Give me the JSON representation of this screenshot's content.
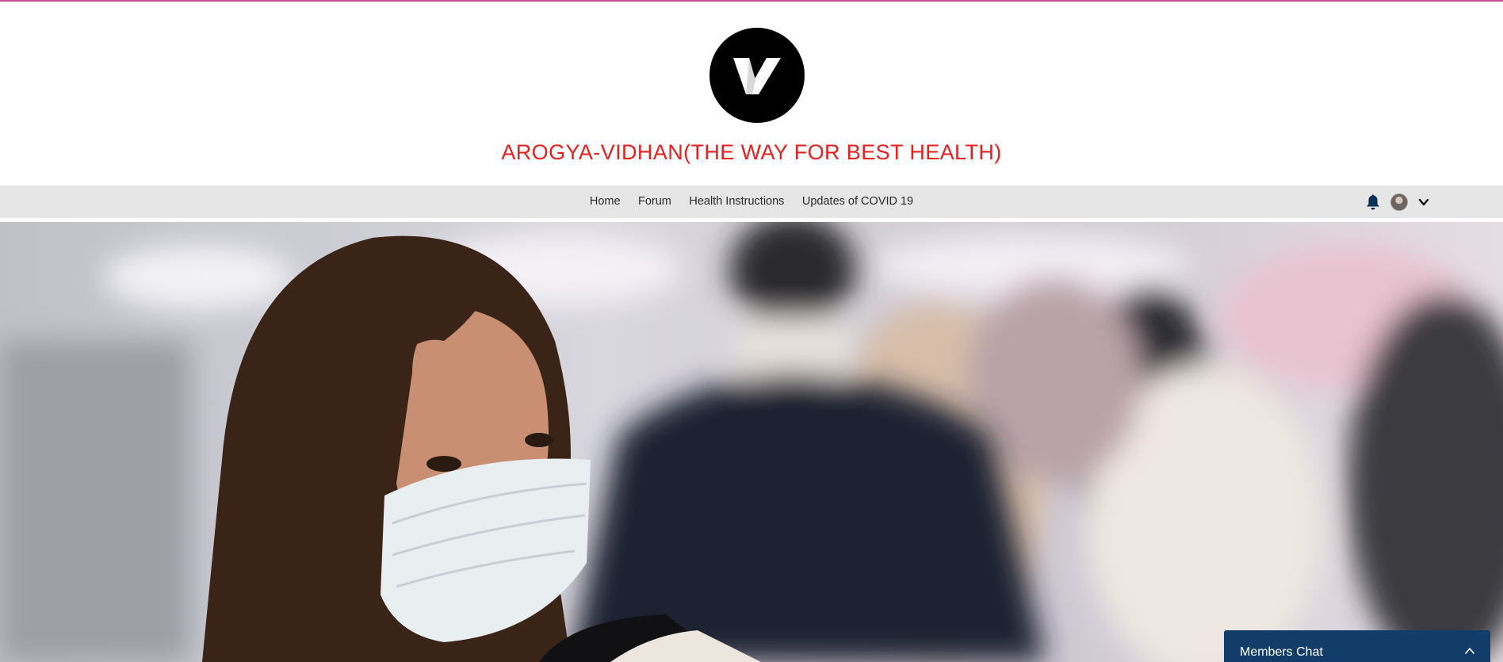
{
  "site": {
    "title": "AROGYA-VIDHAN(THE WAY FOR BEST HEALTH)",
    "logo_icon": "v-logo-icon",
    "title_color": "#ee1c1c",
    "accent_color": "#c2509a"
  },
  "nav": {
    "items": [
      {
        "label": "Home"
      },
      {
        "label": "Forum"
      },
      {
        "label": "Health Instructions"
      },
      {
        "label": "Updates of COVID 19"
      }
    ],
    "notification_icon": "bell-icon",
    "account_icon": "avatar",
    "menu_icon": "chevron-down-icon"
  },
  "hero": {
    "image": "woman-wearing-face-mask-photo"
  },
  "chat": {
    "label": "Members Chat",
    "toggle_icon": "chevron-up-icon",
    "color": "#123d6b"
  }
}
